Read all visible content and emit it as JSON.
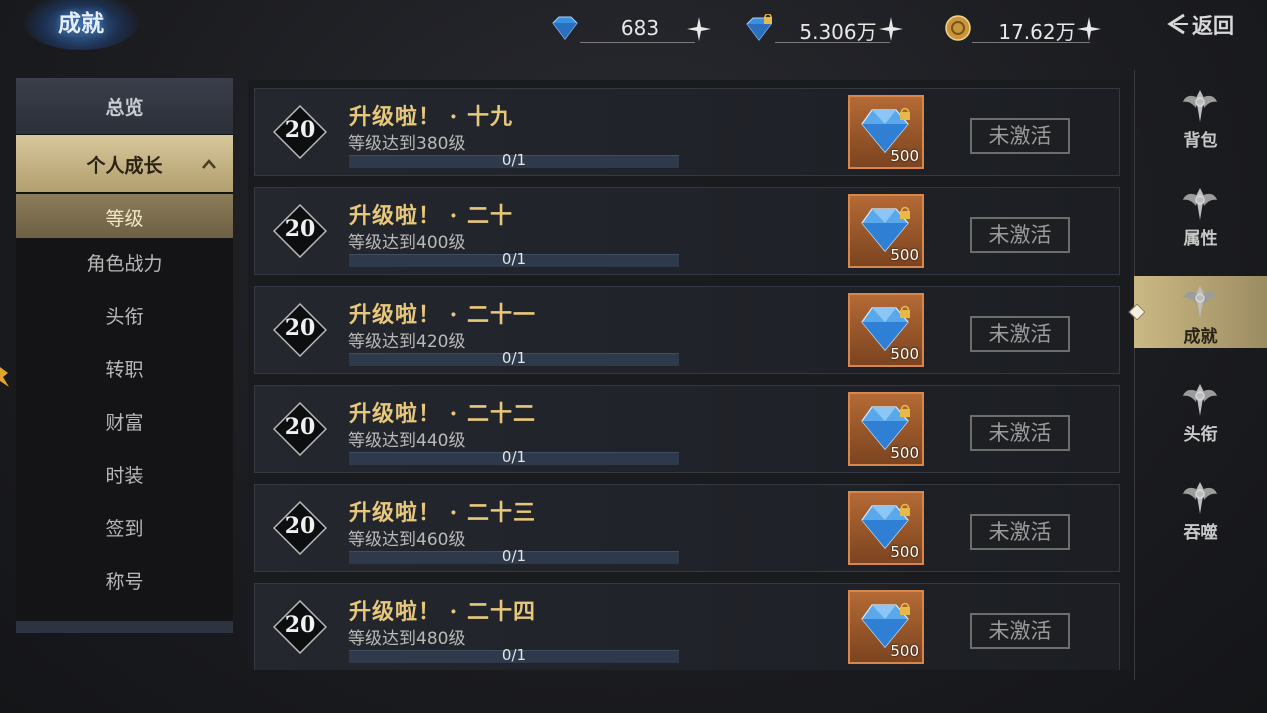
{
  "header": {
    "title": "成就",
    "back_label": "返回",
    "currencies": [
      {
        "icon": "diamond-icon",
        "value": "683"
      },
      {
        "icon": "bound-diamond-icon",
        "value": "5.306万"
      },
      {
        "icon": "gold-coin-icon",
        "value": "17.62万"
      }
    ]
  },
  "sidebar": {
    "heading": "总览",
    "group": "个人成长",
    "selected": "等级",
    "items": [
      "角色战力",
      "头衔",
      "转职",
      "财富",
      "时装",
      "签到",
      "称号"
    ]
  },
  "achievements": [
    {
      "level": "20",
      "title": "升级啦！ · 十九",
      "desc": "等级达到380级",
      "progress_text": "0/1",
      "progress": 0,
      "reward_count": "500",
      "status": "未激活"
    },
    {
      "level": "20",
      "title": "升级啦！ · 二十",
      "desc": "等级达到400级",
      "progress_text": "0/1",
      "progress": 0,
      "reward_count": "500",
      "status": "未激活"
    },
    {
      "level": "20",
      "title": "升级啦！ · 二十一",
      "desc": "等级达到420级",
      "progress_text": "0/1",
      "progress": 0,
      "reward_count": "500",
      "status": "未激活"
    },
    {
      "level": "20",
      "title": "升级啦！ · 二十二",
      "desc": "等级达到440级",
      "progress_text": "0/1",
      "progress": 0,
      "reward_count": "500",
      "status": "未激活"
    },
    {
      "level": "20",
      "title": "升级啦！ · 二十三",
      "desc": "等级达到460级",
      "progress_text": "0/1",
      "progress": 0,
      "reward_count": "500",
      "status": "未激活"
    },
    {
      "level": "20",
      "title": "升级啦！ · 二十四",
      "desc": "等级达到480级",
      "progress_text": "0/1",
      "progress": 0,
      "reward_count": "500",
      "status": "未激活"
    }
  ],
  "right_nav": [
    {
      "label": "背包",
      "active": false
    },
    {
      "label": "属性",
      "active": false
    },
    {
      "label": "成就",
      "active": true
    },
    {
      "label": "头衔",
      "active": false
    },
    {
      "label": "吞噬",
      "active": false
    }
  ],
  "colors": {
    "title_gold": "#e6c77c",
    "accent_tan": "#cbb984",
    "reward_orange": "#b46a35",
    "diamond_blue": "#3b8fe0"
  }
}
